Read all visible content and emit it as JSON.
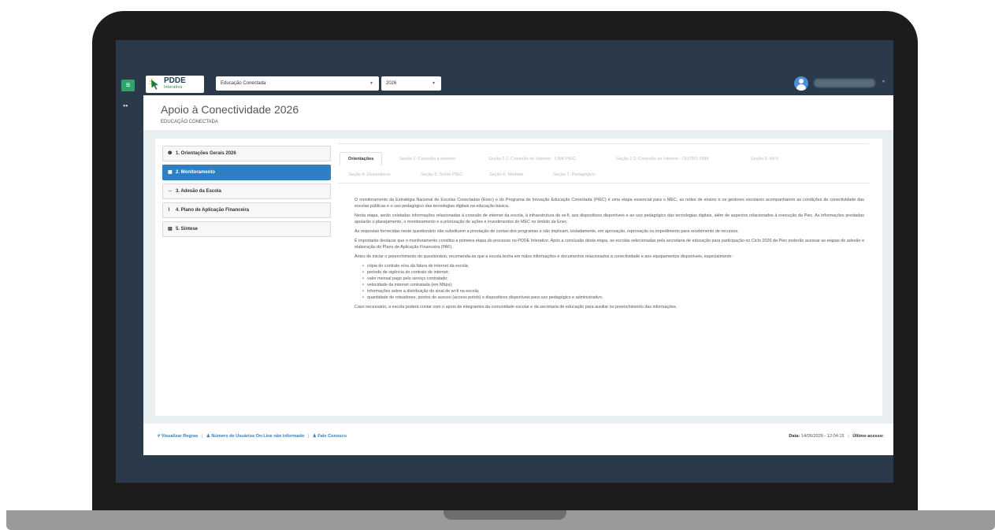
{
  "logo": {
    "title": "PDDE",
    "subtitle": "Interativo"
  },
  "header": {
    "program_select": "Educação Conectada",
    "year_select": "2026",
    "menu_icon": "hamburger-icon",
    "grid_icon": "grid-icon",
    "user_icon": "user-avatar-icon"
  },
  "page": {
    "title": "Apoio à Conectividade 2026",
    "subtitle": "EDUCAÇÃO CONECTADA"
  },
  "sidebar": {
    "items": [
      {
        "icon": "❶",
        "label": "1. Orientações Gerais 2026"
      },
      {
        "icon": "▦",
        "label": "2. Monitoramento"
      },
      {
        "icon": "⇔",
        "label": "3. Adesão da Escola"
      },
      {
        "icon": "⌇",
        "label": "4. Plano de Aplicação Financeira"
      },
      {
        "icon": "▤",
        "label": "5. Síntese"
      }
    ],
    "active_index": 1
  },
  "tabs": [
    {
      "label": "Orientações"
    },
    {
      "label": "Seção 1: Conexão à internet"
    },
    {
      "label": "Seção 2.1: Conexão de Internet - LINK PIEC"
    },
    {
      "label": "Seção 2.2: Conexão de Internet - OUTRO LINK"
    },
    {
      "label": "Seção 3: Wi-fi"
    },
    {
      "label": "Seção 4: Dispositivos"
    },
    {
      "label": "Seção 5: Sobre PIEC"
    },
    {
      "label": "Seção 6: Medidor"
    },
    {
      "label": "Seção 7: Pedagógico"
    }
  ],
  "article": {
    "p1": "O monitoramento da Estratégia Nacional de Escolas Conectadas (Enec) e do Programa de Inovação Educação Conectada (PIEC) é uma etapa essencial para o MEC, as redes de ensino e os gestores escolares acompanharem as condições de conectividade das escolas públicas e o uso pedagógico das tecnologias digitais na educação básica.",
    "p2": "Nesta etapa, serão coletadas informações relacionadas à conexão de internet da escola, à infraestrutura de wi-fi, aos dispositivos disponíveis e ao uso pedagógico das tecnologias digitais, além de aspectos relacionados à execução da Piec. As informações prestadas apoiarão o planejamento, o monitoramento e a priorização de ações e investimentos do MEC no âmbito da Enec.",
    "p3": "As respostas fornecidas neste questionário não substituem a prestação de contas dos programas e não implicam, isoladamente, em aprovação, reprovação ou impedimento para recebimento de recursos.",
    "p4": "É importante destacar que o monitoramento constitui a primeira etapa do processo no PDDE Interativo. Após a conclusão desta etapa, as escolas selecionadas pela secretaria de educação para participação no Ciclo 2026 da Piec poderão acessar as etapas de adesão e elaboração do Plano de Aplicação Financeira (PAF).",
    "p5": "Antes de iniciar o preenchimento do questionário, recomenda-se que a escola tenha em mãos informações e documentos relacionados à conectividade e aos equipamentos disponíveis, especialmente:",
    "list": [
      "cópia do contrato e/ou da fatura de internet da escola;",
      "período de vigência do contrato de internet;",
      "valor mensal pago pelo serviço contratado;",
      "velocidade da internet contratada (em Mbps);",
      "informações sobre a distribuição do sinal de wi-fi na escola;",
      "quantidade de roteadores, pontos de acesso (access points) e dispositivos disponíveis para uso pedagógico e administrativo."
    ],
    "p6": "Caso necessário, a escola poderá contar com o apoio de integrantes da comunidade escolar e da secretaria de educação para auxiliar no preenchimento das informações."
  },
  "footer": {
    "rules": "Visualizar Regras",
    "users_online": "Número de Usuários On-Line não informado",
    "contact": "Fale Conosco",
    "date_label": "Data:",
    "date_value": "14/05/2026 - 12:04:15",
    "last_access_label": "Último acesso:"
  }
}
